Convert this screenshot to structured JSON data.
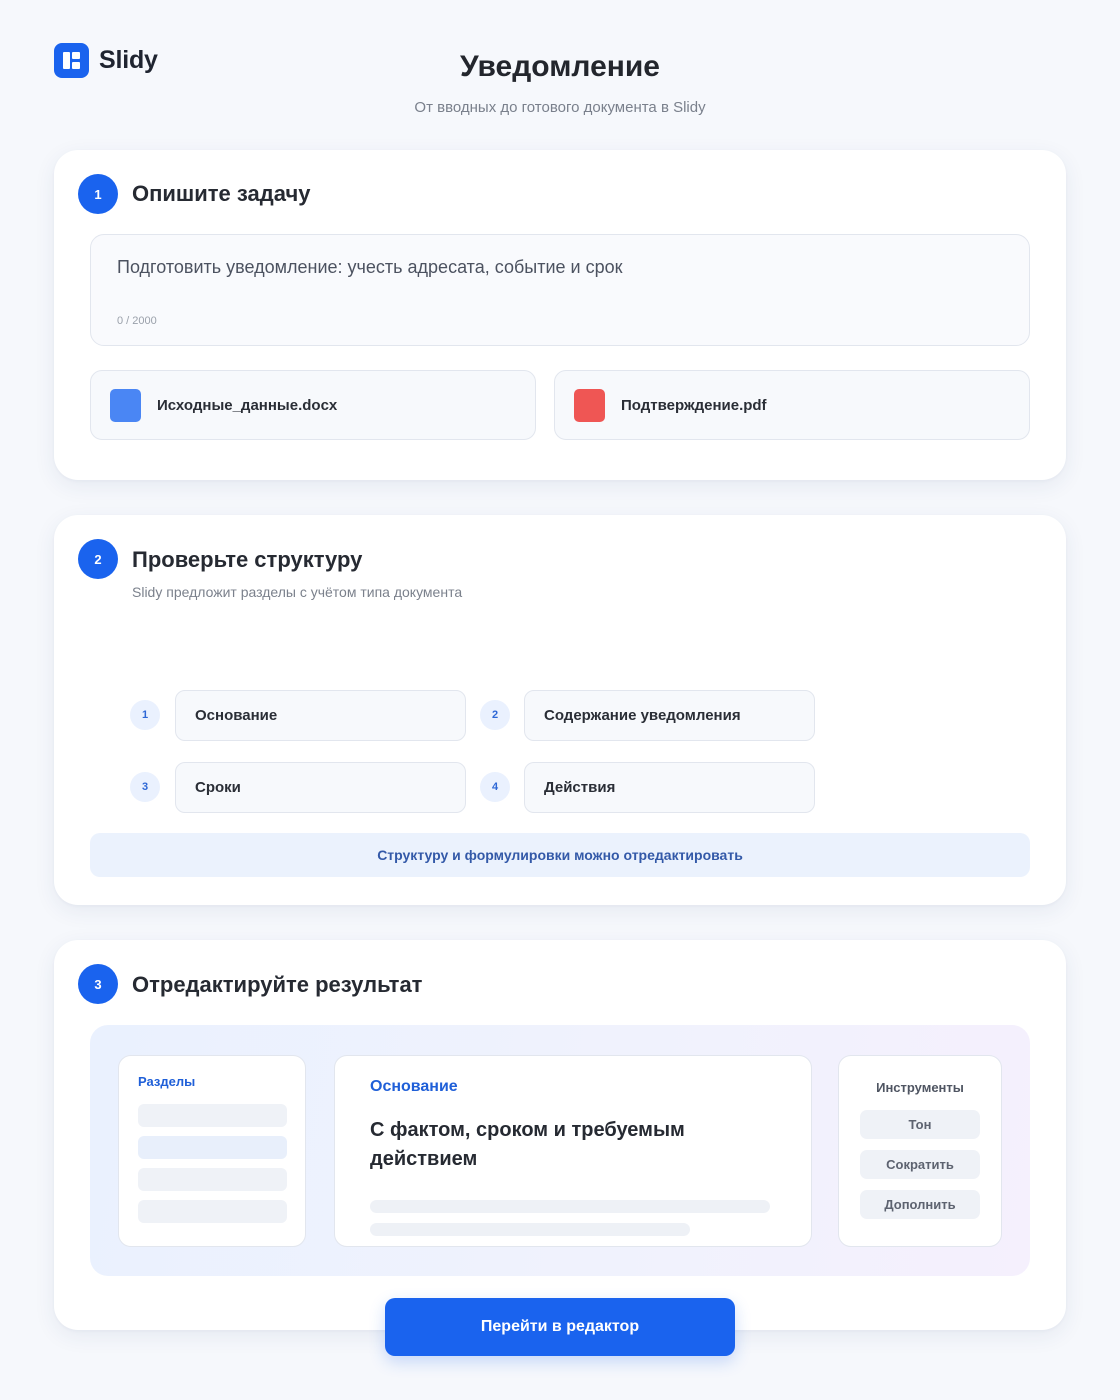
{
  "brand": {
    "name": "Slidy",
    "logo_icon": "slidy-logo-icon",
    "accent": "#1a63ee"
  },
  "header": {
    "title": "Уведомление",
    "subtitle": "От вводных до готового документа в Slidy"
  },
  "step1": {
    "number": "1",
    "title": "Опишите задачу",
    "task": {
      "value": "Подготовить уведомление: учесть адресата, событие и срок",
      "counter": "0 / 2000"
    },
    "files": [
      {
        "name": "Исходные_данные.docx",
        "icon": "docx-file-icon",
        "color": "#4a86f4"
      },
      {
        "name": "Подтверждение.pdf",
        "icon": "pdf-file-icon",
        "color": "#ef5654"
      }
    ]
  },
  "step2": {
    "number": "2",
    "title": "Проверьте структуру",
    "description": "Slidy предложит разделы с учётом типа документа",
    "sections": [
      {
        "number": "1",
        "label": "Основание"
      },
      {
        "number": "2",
        "label": "Содержание уведомления"
      },
      {
        "number": "3",
        "label": "Сроки"
      },
      {
        "number": "4",
        "label": "Действия"
      }
    ],
    "note": "Структуру и формулировки можно отредактировать"
  },
  "step3": {
    "number": "3",
    "title": "Отредактируйте результат",
    "sections_panel": {
      "title": "Разделы"
    },
    "content_panel": {
      "section": "Основание",
      "heading": "С фактом, сроком и требуемым действием"
    },
    "tools_panel": {
      "title": "Инструменты",
      "tools": [
        "Тон",
        "Сократить",
        "Дополнить"
      ]
    }
  },
  "cta": {
    "label": "Перейти в редактор"
  }
}
